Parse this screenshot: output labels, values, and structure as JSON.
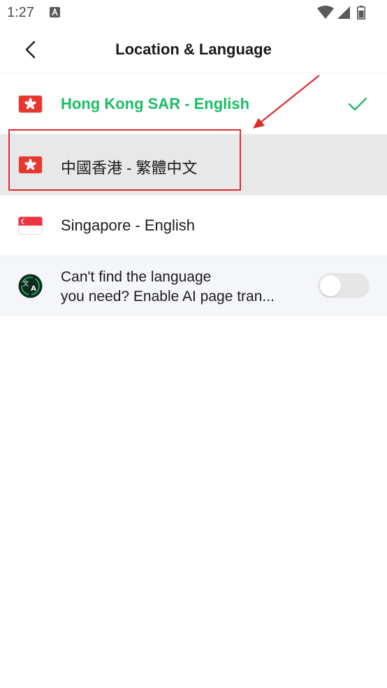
{
  "status_bar": {
    "time": "1:27",
    "icons": [
      "app-notification-icon",
      "wifi-icon",
      "signal-icon",
      "battery-icon"
    ]
  },
  "header": {
    "title": "Location & Language",
    "back_icon": "chevron-left-icon"
  },
  "languages": [
    {
      "label": "Hong Kong SAR - English",
      "flag": "hong-kong-flag-icon",
      "selected": true
    },
    {
      "label": "中國香港 - 繁體中文",
      "flag": "hong-kong-flag-icon",
      "selected": false
    },
    {
      "label": "Singapore - English",
      "flag": "singapore-flag-icon",
      "selected": false
    }
  ],
  "ai_translation": {
    "line1": "Can't find the language",
    "line2": "you need? Enable AI page tran...",
    "enabled": false
  },
  "colors": {
    "accent_green": "#1bbd65",
    "annotation_red": "#e02b2b",
    "flag_red": "#e8372f",
    "highlight_bg": "#e8e8e8"
  }
}
